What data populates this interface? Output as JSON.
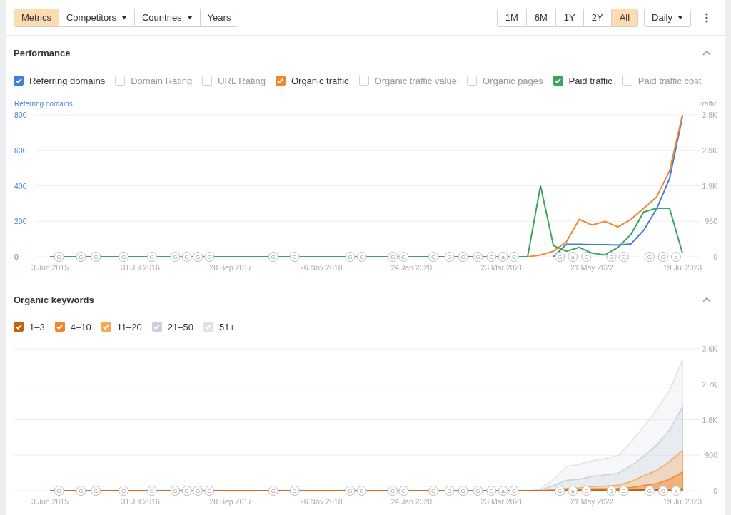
{
  "toolbar": {
    "view_buttons": [
      {
        "label": "Metrics",
        "selected": true,
        "dropdown": false
      },
      {
        "label": "Competitors",
        "selected": false,
        "dropdown": true
      },
      {
        "label": "Countries",
        "selected": false,
        "dropdown": true
      },
      {
        "label": "Years",
        "selected": false,
        "dropdown": false
      }
    ],
    "range_buttons": [
      {
        "label": "1M",
        "selected": false
      },
      {
        "label": "6M",
        "selected": false
      },
      {
        "label": "1Y",
        "selected": false
      },
      {
        "label": "2Y",
        "selected": false
      },
      {
        "label": "All",
        "selected": true
      }
    ],
    "interval": {
      "label": "Daily"
    }
  },
  "performance": {
    "title": "Performance",
    "expanded": true,
    "metrics": [
      {
        "label": "Referring domains",
        "checked": true,
        "color": "#3d7fdb"
      },
      {
        "label": "Domain Rating",
        "checked": false
      },
      {
        "label": "URL Rating",
        "checked": false
      },
      {
        "label": "Organic traffic",
        "checked": true,
        "color": "#f2862c"
      },
      {
        "label": "Organic traffic value",
        "checked": false
      },
      {
        "label": "Organic pages",
        "checked": false
      },
      {
        "label": "Paid traffic",
        "checked": true,
        "color": "#3aa55e"
      },
      {
        "label": "Paid traffic cost",
        "checked": false
      }
    ],
    "chart_data": {
      "type": "line",
      "ylabel": "Referring domains",
      "y2label": "Traffic",
      "grid": true,
      "categories": [
        "3 Jun 2015",
        null,
        null,
        null,
        null,
        null,
        null,
        "31 Jul 2016",
        null,
        null,
        null,
        null,
        null,
        null,
        "28 Sep 2017",
        null,
        null,
        null,
        null,
        null,
        null,
        "26 Nov 2018",
        null,
        null,
        null,
        null,
        null,
        null,
        "24 Jan 2020",
        null,
        null,
        null,
        null,
        null,
        null,
        "23 Mar 2021",
        null,
        null,
        null,
        null,
        null,
        null,
        "21 May 2022",
        null,
        null,
        null,
        null,
        null,
        null,
        "19 Jul 2023"
      ],
      "ylim": [
        0,
        800
      ],
      "yticks": [
        {
          "value": 0,
          "label": "0"
        },
        200,
        400,
        600,
        800
      ],
      "y2lim": [
        0,
        3800
      ],
      "y2ticks": [
        {
          "value": 0,
          "label": "0"
        },
        {
          "value": 950,
          "label": "950"
        },
        {
          "value": 1900,
          "label": "1.9K"
        },
        {
          "value": 2850,
          "label": "2.9K"
        },
        {
          "value": 3800,
          "label": "3.8K"
        }
      ],
      "series": [
        {
          "color": "#3d7fdb",
          "values": [
            null,
            null,
            null,
            null,
            null,
            null,
            null,
            null,
            null,
            null,
            null,
            null,
            null,
            null,
            null,
            null,
            null,
            null,
            null,
            null,
            null,
            null,
            null,
            null,
            null,
            null,
            null,
            null,
            null,
            null,
            null,
            null,
            null,
            null,
            null,
            null,
            null,
            null,
            null,
            0,
            70,
            70,
            68,
            68,
            66,
            72,
            150,
            270,
            440,
            790
          ]
        },
        {
          "color": "#f2862c",
          "axis": "y2",
          "values": [
            null,
            null,
            null,
            null,
            null,
            null,
            null,
            null,
            null,
            null,
            null,
            null,
            null,
            null,
            null,
            null,
            null,
            null,
            null,
            null,
            null,
            null,
            null,
            null,
            null,
            null,
            null,
            null,
            null,
            null,
            null,
            null,
            null,
            null,
            null,
            null,
            null,
            0,
            50,
            150,
            400,
            1000,
            850,
            950,
            800,
            1000,
            1300,
            1600,
            2300,
            3800
          ]
        },
        {
          "color": "#3aa55e",
          "axis": "y2",
          "values": [
            0,
            0,
            0,
            0,
            0,
            0,
            0,
            0,
            0,
            0,
            0,
            0,
            0,
            0,
            0,
            0,
            0,
            0,
            0,
            0,
            0,
            0,
            0,
            0,
            0,
            0,
            0,
            0,
            0,
            0,
            0,
            0,
            0,
            0,
            0,
            0,
            0,
            0,
            1900,
            300,
            150,
            250,
            100,
            50,
            250,
            600,
            1200,
            1300,
            1300,
            100
          ]
        }
      ],
      "annotations": [
        {
          "text": "G"
        },
        {
          "text": "G"
        },
        {
          "text": "G"
        },
        {
          "text": "G"
        },
        {
          "text": "G"
        },
        {
          "text": "G"
        },
        {
          "text": "G"
        },
        {
          "text": "G"
        },
        {
          "text": "G"
        },
        {
          "text": "G"
        },
        {
          "text": "G"
        },
        {
          "text": "G"
        },
        {
          "text": "G"
        },
        {
          "text": "G"
        },
        {
          "text": "G"
        },
        {
          "text": "G"
        },
        {
          "text": "G"
        },
        {
          "text": "G"
        },
        {
          "text": "G"
        },
        {
          "text": "G"
        },
        {
          "text": "a"
        },
        {
          "text": "G"
        },
        {
          "text": "G"
        },
        {
          "text": "a"
        },
        {
          "text": "G"
        },
        {
          "text": "G"
        },
        {
          "text": "G"
        },
        {
          "text": "G"
        },
        {
          "text": "G"
        },
        {
          "text": "a"
        }
      ]
    }
  },
  "organic_keywords": {
    "title": "Organic keywords",
    "expanded": true,
    "positions": [
      {
        "label": "1–3",
        "checked": true,
        "color": "#c4620f"
      },
      {
        "label": "4–10",
        "checked": true,
        "color": "#f2862c"
      },
      {
        "label": "11–20",
        "checked": true,
        "color": "#f7a957"
      },
      {
        "label": "21–50",
        "checked": true,
        "color": "#c9d0da"
      },
      {
        "label": "51+",
        "checked": true,
        "color": "#dfe3e9"
      }
    ],
    "chart_data": {
      "type": "area",
      "stacked": true,
      "grid": true,
      "categories": [
        "3 Jun 2015",
        null,
        null,
        null,
        null,
        null,
        null,
        "31 Jul 2016",
        null,
        null,
        null,
        null,
        null,
        null,
        "28 Sep 2017",
        null,
        null,
        null,
        null,
        null,
        null,
        "26 Nov 2018",
        null,
        null,
        null,
        null,
        null,
        null,
        "24 Jan 2020",
        null,
        null,
        null,
        null,
        null,
        null,
        "23 Mar 2021",
        null,
        null,
        null,
        null,
        null,
        null,
        "21 May 2022",
        null,
        null,
        null,
        null,
        null,
        null,
        "19 Jul 2023"
      ],
      "y2lim": [
        0,
        3600
      ],
      "y2ticks": [
        {
          "value": 0,
          "label": "0"
        },
        {
          "value": 900,
          "label": "900"
        },
        {
          "value": 1800,
          "label": "1.8K"
        },
        {
          "value": 2700,
          "label": "2.7K"
        },
        {
          "value": 3600,
          "label": "3.6K"
        }
      ],
      "series": [
        {
          "color": "#c4620f",
          "axis": "y2",
          "values": [
            0,
            0,
            0,
            0,
            0,
            0,
            0,
            0,
            0,
            0,
            0,
            0,
            0,
            0,
            0,
            0,
            0,
            0,
            0,
            0,
            0,
            0,
            0,
            0,
            0,
            0,
            0,
            0,
            0,
            0,
            0,
            0,
            0,
            0,
            0,
            0,
            0,
            0,
            0,
            0,
            10,
            10,
            20,
            20,
            20,
            20,
            30,
            30,
            40,
            50
          ]
        },
        {
          "color": "#f2862c",
          "axis": "y2",
          "values": [
            0,
            0,
            0,
            0,
            0,
            0,
            0,
            0,
            0,
            0,
            0,
            0,
            0,
            0,
            0,
            0,
            0,
            0,
            0,
            0,
            0,
            0,
            0,
            0,
            0,
            0,
            0,
            0,
            0,
            0,
            0,
            0,
            0,
            0,
            0,
            0,
            0,
            0,
            0,
            10,
            20,
            20,
            30,
            30,
            40,
            60,
            100,
            150,
            250,
            420
          ]
        },
        {
          "color": "#f7a957",
          "axis": "y2",
          "values": [
            0,
            0,
            0,
            0,
            0,
            0,
            0,
            0,
            0,
            0,
            0,
            0,
            0,
            0,
            0,
            0,
            0,
            0,
            0,
            0,
            0,
            0,
            0,
            0,
            0,
            0,
            0,
            0,
            0,
            0,
            0,
            0,
            0,
            0,
            0,
            0,
            0,
            0,
            0,
            20,
            30,
            40,
            60,
            70,
            80,
            150,
            250,
            330,
            450,
            550
          ]
        },
        {
          "color": "#c9d0da",
          "axis": "y2",
          "values": [
            0,
            0,
            0,
            0,
            0,
            0,
            0,
            0,
            0,
            0,
            0,
            0,
            0,
            0,
            0,
            0,
            0,
            0,
            0,
            0,
            0,
            0,
            0,
            0,
            0,
            0,
            0,
            0,
            0,
            0,
            0,
            0,
            0,
            0,
            0,
            0,
            0,
            0,
            20,
            100,
            200,
            220,
            250,
            280,
            300,
            400,
            500,
            650,
            800,
            1100
          ]
        },
        {
          "color": "#dfe3e9",
          "axis": "y2",
          "values": [
            0,
            0,
            0,
            0,
            0,
            0,
            0,
            0,
            0,
            0,
            0,
            0,
            0,
            0,
            0,
            0,
            0,
            0,
            0,
            0,
            0,
            0,
            0,
            0,
            0,
            0,
            0,
            0,
            0,
            0,
            0,
            0,
            0,
            0,
            0,
            0,
            0,
            0,
            30,
            150,
            350,
            380,
            400,
            420,
            450,
            600,
            750,
            900,
            1000,
            1200
          ]
        }
      ],
      "annotations": [
        {
          "text": "G"
        },
        {
          "text": "G"
        },
        {
          "text": "G"
        },
        {
          "text": "G"
        },
        {
          "text": "G"
        },
        {
          "text": "G"
        },
        {
          "text": "G"
        },
        {
          "text": "G"
        },
        {
          "text": "G"
        },
        {
          "text": "G"
        },
        {
          "text": "G"
        },
        {
          "text": "G"
        },
        {
          "text": "G"
        },
        {
          "text": "G"
        },
        {
          "text": "G"
        },
        {
          "text": "G"
        },
        {
          "text": "G"
        },
        {
          "text": "G"
        },
        {
          "text": "G"
        },
        {
          "text": "G"
        },
        {
          "text": "a"
        },
        {
          "text": "G"
        },
        {
          "text": "G"
        },
        {
          "text": "a"
        },
        {
          "text": "G"
        },
        {
          "text": "G"
        },
        {
          "text": "G"
        },
        {
          "text": "G"
        },
        {
          "text": "G"
        },
        {
          "text": "a"
        }
      ]
    }
  }
}
